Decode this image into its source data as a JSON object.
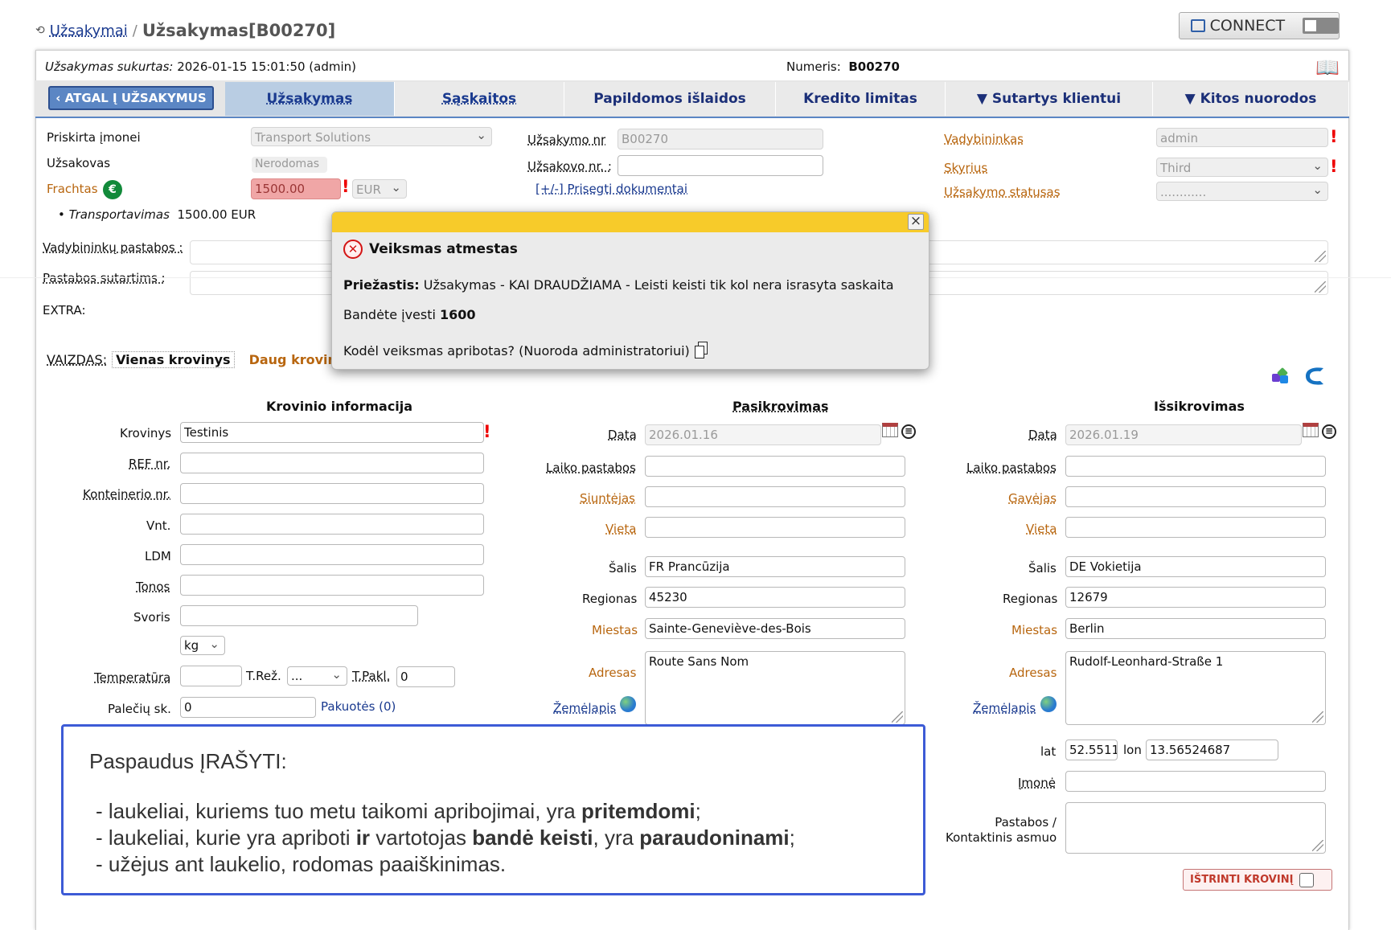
{
  "breadcrumb": {
    "parent": "Užsakymai",
    "separator": "/",
    "current": "Užsakymas[B00270]"
  },
  "connect": {
    "label": "CONNECT"
  },
  "info_bar": {
    "created_label": "Užsakymas sukurtas:",
    "created_value": "2026-01-15 15:01:50 (admin)",
    "number_label": "Numeris:",
    "number_value": "B00270"
  },
  "tabs": {
    "back": "‹ ATGAL Į UŽSAKYMUS",
    "items": [
      "Užsakymas",
      "Sąskaitos",
      "Papildomos išlaidos",
      "Kredito limitas",
      "▼ Sutartys klientui",
      "▼ Kitos nuorodos"
    ]
  },
  "order": {
    "assigned_label": "Priskirta įmonei",
    "assigned_value": "Transport Solutions",
    "customer_label": "Užsakovas",
    "customer_value": "Nerodomas",
    "freight_label": "Frachtas",
    "freight_value": "1500.00",
    "currency": "EUR",
    "transport_label": "Transportavimas",
    "transport_value": "1500.00 EUR",
    "order_nr_label": "Užsakymo nr",
    "order_nr_value": "B00270",
    "customer_nr_label": "Užsakovo nr. :",
    "attach": "[+/-] Prisegti dokumentai",
    "manager_label": "Vadybininkas",
    "manager_value": "admin",
    "department_label": "Skyrius",
    "department_value": "Third",
    "status_label": "Užsakymo statusas",
    "status_value": "............",
    "manager_notes_label": "Vadybininkų pastabos :",
    "contract_notes_label": "Pastabos sutartims :",
    "extra_label": "EXTRA:"
  },
  "view": {
    "label": "VAIZDAS:",
    "single": "Vienas krovinys",
    "multi": "Daug kroviniu"
  },
  "cargo": {
    "heading": "Krovinio informacija",
    "cargo_label": "Krovinys",
    "cargo_value": "Testinis",
    "ref_label": "REF nr.",
    "container_label": "Konteinerio nr.",
    "units_label": "Vnt.",
    "ldm_label": "LDM",
    "tons_label": "Tonos",
    "weight_label": "Svoris",
    "unit_value": "kg",
    "temp_label": "Temperatūra",
    "treg_label": "T.Rež.",
    "treg_value": "...",
    "tpakl_label": "T.Pakl.",
    "tpakl_value": "0",
    "pallets_label": "Palečių sk.",
    "pallets_value": "0",
    "packages_link": "Pakuotės (0)"
  },
  "loading": {
    "heading": "Pasikrovimas",
    "date_label": "Data",
    "date_value": "2026.01.16",
    "time_notes_label": "Laiko pastabos",
    "party_label": "Siuntėjas",
    "place_label": "Vieta",
    "country_label": "Šalis",
    "country_value": "FR Prancūzija",
    "region_label": "Regionas",
    "region_value": "45230",
    "city_label": "Miestas",
    "city_value": "Sainte-Geneviève-des-Bois",
    "address_label": "Adresas",
    "address_value": "Route Sans Nom",
    "map_label": "Žemėlapis"
  },
  "unloading": {
    "heading": "Išsikrovimas",
    "date_label": "Data",
    "date_value": "2026.01.19",
    "time_notes_label": "Laiko pastabos",
    "party_label": "Gavėjas",
    "place_label": "Vieta",
    "country_label": "Šalis",
    "country_value": "DE Vokietija",
    "region_label": "Regionas",
    "region_value": "12679",
    "city_label": "Miestas",
    "city_value": "Berlin",
    "address_label": "Adresas",
    "address_value": "Rudolf-Leonhard-Straße 1",
    "map_label": "Žemėlapis",
    "lat_label": "lat",
    "lat_value": "52.5511",
    "lon_label": "lon",
    "lon_value": "13.56524687",
    "company_label": "Įmonė",
    "notes_label_1": "Pastabos /",
    "notes_label_2": "Kontaktinis asmuo",
    "delete_button": "IŠTRINTI KROVINĮ"
  },
  "modal": {
    "title": "Veiksmas atmestas",
    "reason_label": "Priežastis:",
    "reason_value": "Užsakymas - KAI DRAUDŽIAMA - Leisti keisti tik kol nera israsyta saskaita",
    "attempt_label": "Bandėte įvesti",
    "attempt_value": "1600",
    "why": "Kodėl veiksmas apribotas? (Nuoroda administratoriui)",
    "close": "×"
  },
  "note": {
    "title": "Paspaudus ĮRAŠYTI:",
    "l1a": "- laukeliai, kuriems tuo metu taikomi apribojimai, yra ",
    "l1b": "pritemdomi",
    "l1c": ";",
    "l2a": "- laukeliai, kurie yra apriboti ",
    "l2b": "ir",
    "l2c": " vartotojas ",
    "l2d": "bandė keisti",
    "l2e": ", yra ",
    "l2f": "paraudoninami",
    "l2g": ";",
    "l3": "- užėjus ant laukelio, rodomas paaiškinimas."
  },
  "colors": {
    "tab_active": "#b9cde3",
    "tab_back": "#5b86c4",
    "modal_header": "#f7cb2a",
    "note_border": "#3d5bd6",
    "error": "#d31414",
    "link": "#1a3a8f",
    "orange_label": "#b8660f"
  }
}
